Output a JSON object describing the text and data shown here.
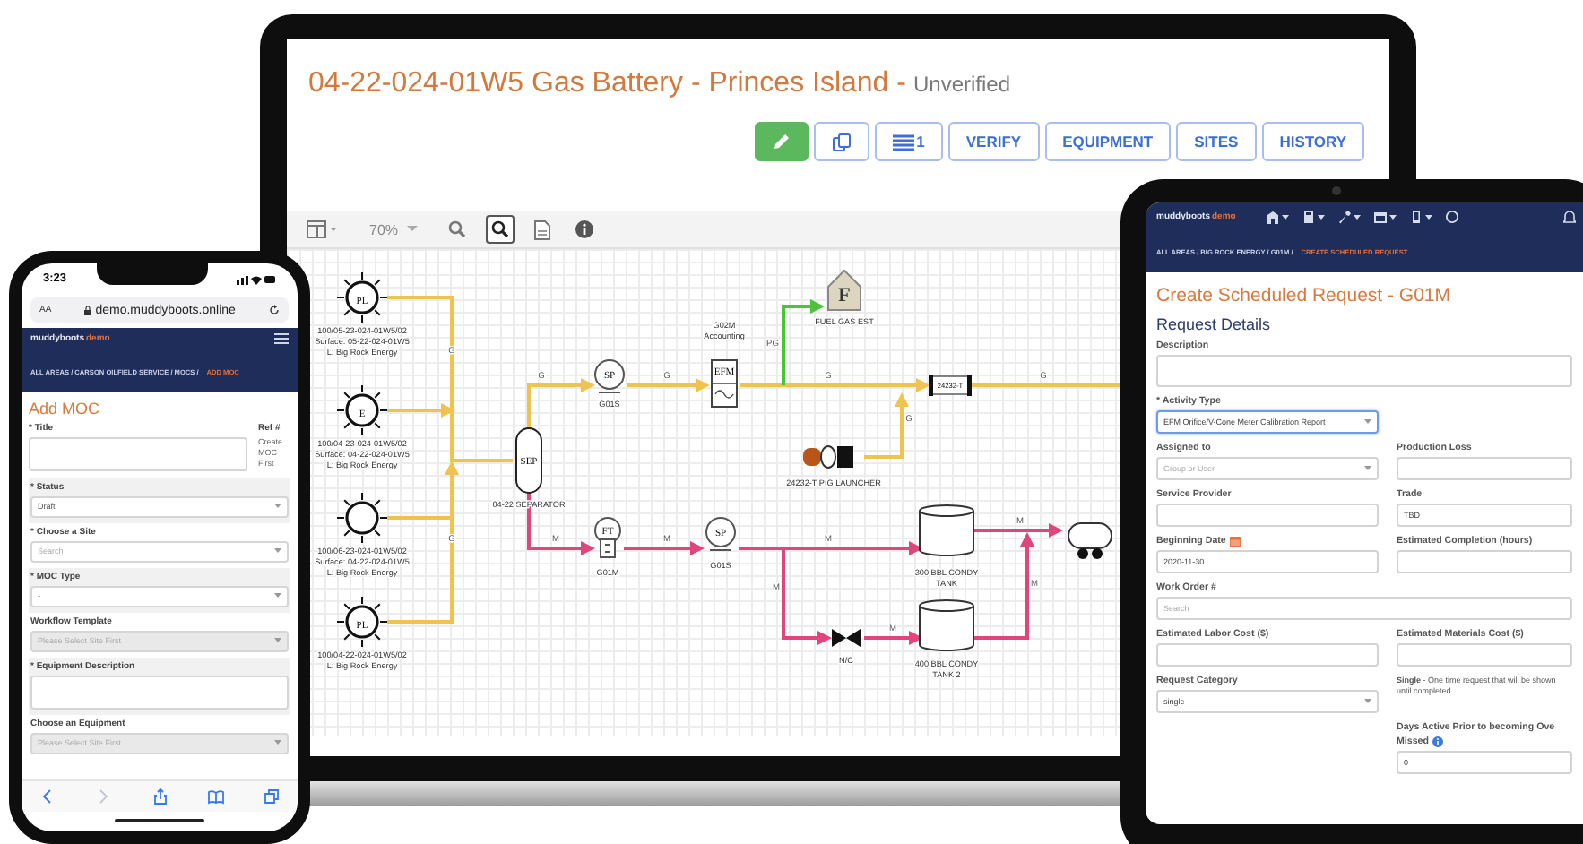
{
  "laptop": {
    "title": "04-22-024-01W5 Gas Battery - Princes Island -",
    "status": "Unverified",
    "action_buttons": [
      {
        "kind": "edit"
      },
      {
        "kind": "copy"
      },
      {
        "kind": "list",
        "label": "1"
      },
      {
        "kind": "text",
        "label": "VERIFY"
      },
      {
        "kind": "text",
        "label": "EQUIPMENT"
      },
      {
        "kind": "text",
        "label": "SITES"
      },
      {
        "kind": "text",
        "label": "HISTORY"
      }
    ],
    "toolbar": {
      "zoom_level": "70%",
      "tools": [
        {
          "kind": "layout",
          "selected": false
        },
        {
          "kind": "zoom-out",
          "selected": false
        },
        {
          "kind": "zoom-in",
          "selected": true
        },
        {
          "kind": "pdf",
          "selected": false
        },
        {
          "kind": "info",
          "selected": false
        }
      ]
    },
    "diagram": {
      "wells": [
        {
          "symbol": "PL",
          "label": [
            "100/05-23-024-01W5/02",
            "Surface: 05-22-024-01W5",
            "L: Big Rock Energy"
          ]
        },
        {
          "symbol": "E",
          "label": [
            "100/04-23-024-01W5/02",
            "Surface: 04-22-024-01W5",
            "L: Big Rock Energy"
          ]
        },
        {
          "label": [
            "100/06-23-024-01W5/02",
            "Surface: 04-22-024-01W5",
            "L: Big Rock Energy"
          ]
        },
        {
          "symbol": "PL",
          "label": [
            "100/04-22-024-01W5/02",
            "L: Big Rock Energy"
          ]
        }
      ],
      "nodes": [
        {
          "kind": "separator",
          "symbol": "SEP",
          "label": [
            "04-22 SEPARATOR"
          ]
        },
        {
          "kind": "sample-point",
          "symbol": "SP",
          "label": [
            "G01S"
          ]
        },
        {
          "kind": "flow-meter",
          "symbol": "EFM",
          "label": [
            "G02M",
            "Accounting"
          ]
        },
        {
          "kind": "fuel",
          "symbol": "F",
          "label": [
            "FUEL GAS EST"
          ]
        },
        {
          "kind": "inline-meter",
          "symbol": "24232-T"
        },
        {
          "kind": "pig-launcher",
          "label": [
            "24232-T PIG LAUNCHER"
          ]
        },
        {
          "kind": "flow-transmitter",
          "symbol": "FT",
          "label": [
            "G01M"
          ]
        },
        {
          "kind": "sample-point",
          "symbol": "SP",
          "label": [
            "G01S"
          ]
        },
        {
          "kind": "tank",
          "label": [
            "300 BBL CONDY",
            "TANK"
          ]
        },
        {
          "kind": "tank",
          "label": [
            "400 BBL CONDY",
            "TANK 2"
          ]
        },
        {
          "kind": "valve",
          "label": [
            "N/C"
          ]
        },
        {
          "kind": "vessel"
        }
      ],
      "pipes": [
        {
          "kind": "gas",
          "label": "G"
        },
        {
          "kind": "gas",
          "label": "G"
        },
        {
          "kind": "gas",
          "label": "G"
        },
        {
          "kind": "gas",
          "label": "G"
        },
        {
          "kind": "gas",
          "label": "G"
        },
        {
          "kind": "fuel",
          "label": "PG"
        },
        {
          "kind": "gas",
          "label": "G"
        },
        {
          "kind": "gas",
          "label": "G"
        },
        {
          "kind": "liquid",
          "label": "M"
        },
        {
          "kind": "liquid",
          "label": "M"
        },
        {
          "kind": "liquid",
          "label": "M"
        },
        {
          "kind": "liquid",
          "label": "M"
        },
        {
          "kind": "liquid",
          "label": "M"
        },
        {
          "kind": "liquid",
          "label": "M"
        },
        {
          "kind": "liquid",
          "label": "M"
        }
      ]
    }
  },
  "phone": {
    "time": "3:23",
    "text_size": "AA",
    "url": "demo.muddyboots.online",
    "brand": "muddyboots",
    "brand_suffix": "demo",
    "breadcrumb": "ALL AREAS / CARSON OILFIELD SERVICE / MOCS /",
    "breadcrumb_current": "ADD MOC",
    "heading": "Add MOC",
    "title_label": "* Title",
    "ref_label": "Ref #",
    "ref_value": "Create MOC First",
    "fields": [
      {
        "kind": "select",
        "label": "* Status",
        "value": "Draft",
        "disabled": false
      },
      {
        "kind": "select",
        "label": "* Choose a Site",
        "placeholder": "Search",
        "disabled": false
      },
      {
        "kind": "select",
        "label": "* MOC Type",
        "value": "-",
        "disabled": false
      },
      {
        "kind": "select",
        "label": "Workflow Template",
        "placeholder": "Please Select Site First",
        "disabled": true
      },
      {
        "kind": "textarea",
        "label": "* Equipment Description",
        "disabled": false
      },
      {
        "kind": "select",
        "label": "Choose an Equipment",
        "placeholder": "Please Select Site First",
        "disabled": true
      }
    ],
    "toolbar": [
      {
        "kind": "back",
        "disabled": false
      },
      {
        "kind": "forward",
        "disabled": true
      },
      {
        "kind": "share",
        "disabled": false
      },
      {
        "kind": "bookmarks",
        "disabled": false
      },
      {
        "kind": "tabs",
        "disabled": false
      }
    ]
  },
  "tablet": {
    "brand": "muddyboots",
    "brand_suffix": "demo",
    "nav_icons": [
      {
        "kind": "building",
        "dropdown": true
      },
      {
        "kind": "calculator",
        "dropdown": true
      },
      {
        "kind": "tools",
        "dropdown": true
      },
      {
        "kind": "calendar",
        "dropdown": true
      },
      {
        "kind": "phone",
        "dropdown": true
      },
      {
        "kind": "help",
        "dropdown": false
      }
    ],
    "breadcrumb": "ALL AREAS / BIG ROCK ENERGY / G01M /",
    "breadcrumb_current": "CREATE SCHEDULED REQUEST",
    "heading": "Create Scheduled Request - G01M",
    "section": "Request Details",
    "rows": [
      {
        "kind": "full",
        "fields": [
          {
            "kind": "textarea",
            "label": "Description",
            "focused": false
          }
        ]
      },
      {
        "kind": "split",
        "fields": [
          {
            "kind": "select",
            "label": "* Activity Type",
            "value": "EFM Orifice/V-Cone Meter Calibration Report",
            "focused": true
          }
        ]
      },
      {
        "kind": "split",
        "fields": [
          {
            "kind": "select",
            "label": "Assigned to",
            "placeholder": "Group or User",
            "focused": false
          },
          {
            "kind": "input",
            "label": "Production Loss",
            "focused": false
          }
        ]
      },
      {
        "kind": "split",
        "fields": [
          {
            "kind": "input",
            "label": "Service Provider",
            "focused": false
          },
          {
            "kind": "input",
            "label": "Trade",
            "value": "TBD",
            "focused": false
          }
        ]
      },
      {
        "kind": "split",
        "fields": [
          {
            "kind": "date",
            "label": "Beginning Date",
            "value": "2020-11-30",
            "focused": false
          },
          {
            "kind": "input",
            "label": "Estimated Completion (hours)",
            "focused": false
          }
        ]
      },
      {
        "kind": "full",
        "fields": [
          {
            "kind": "input",
            "label": "Work Order #",
            "placeholder": "Search",
            "focused": false
          }
        ]
      },
      {
        "kind": "split",
        "fields": [
          {
            "kind": "input",
            "label": "Estimated Labor Cost ($)",
            "focused": false
          },
          {
            "kind": "input",
            "label": "Estimated Materials Cost ($)",
            "focused": false
          }
        ]
      },
      {
        "kind": "split",
        "fields": [
          {
            "kind": "select",
            "label": "Request Category",
            "value": "single",
            "focused": false
          },
          {
            "kind": "note",
            "text": "**Single** - One time request that will be shown until completed"
          }
        ]
      },
      {
        "kind": "split",
        "fields": [
          {
            "kind": "blank"
          },
          {
            "kind": "info-input",
            "label": "Days Active Prior to becoming Ove",
            "sublabel": "Missed",
            "value": "0",
            "focused": false
          }
        ]
      }
    ]
  }
}
